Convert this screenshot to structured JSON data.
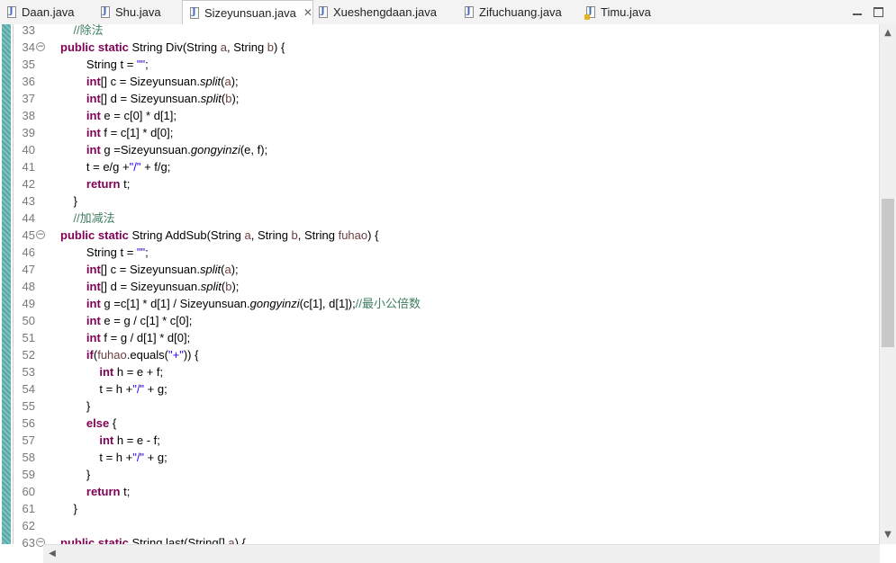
{
  "tabs": [
    {
      "label": "Daan.java",
      "warn": false
    },
    {
      "label": "Shu.java",
      "warn": false
    },
    {
      "label": "Sizeyunsuan.java",
      "warn": false,
      "active": true
    },
    {
      "label": "Xueshengdaan.java",
      "warn": false
    },
    {
      "label": "Zifuchuang.java",
      "warn": false
    },
    {
      "label": "Timu.java",
      "warn": true
    }
  ],
  "tab_close_glyph": "✕",
  "icons": {
    "file": "java-file-icon",
    "close": "close-icon",
    "minimize": "minimize-icon",
    "maximize": "maximize-icon",
    "fold": "fold-collapse-icon",
    "scroll_up": "scroll-up-icon",
    "scroll_down": "scroll-down-icon",
    "scroll_left": "scroll-left-icon"
  },
  "editor": {
    "fold_glyph": "−",
    "lines": [
      {
        "n": "33",
        "fold": false,
        "tokens": [
          [
            "c",
            "    //除法"
          ]
        ]
      },
      {
        "n": "34",
        "fold": true,
        "tokens": [
          [
            "k",
            "public"
          ],
          [
            "t",
            " "
          ],
          [
            "k",
            "static"
          ],
          [
            "t",
            " String Div(String "
          ],
          [
            "p",
            "a"
          ],
          [
            "t",
            ", String "
          ],
          [
            "p",
            "b"
          ],
          [
            "t",
            ") {"
          ]
        ]
      },
      {
        "n": "35",
        "fold": false,
        "tokens": [
          [
            "t",
            "        String t = "
          ],
          [
            "s",
            "\"\""
          ],
          [
            "t",
            ";"
          ]
        ]
      },
      {
        "n": "36",
        "fold": false,
        "tokens": [
          [
            "t",
            "        "
          ],
          [
            "k",
            "int"
          ],
          [
            "t",
            "[] c = Sizeyunsuan."
          ],
          [
            "m",
            "split"
          ],
          [
            "t",
            "("
          ],
          [
            "p",
            "a"
          ],
          [
            "t",
            ");"
          ]
        ]
      },
      {
        "n": "37",
        "fold": false,
        "tokens": [
          [
            "t",
            "        "
          ],
          [
            "k",
            "int"
          ],
          [
            "t",
            "[] d = Sizeyunsuan."
          ],
          [
            "m",
            "split"
          ],
          [
            "t",
            "("
          ],
          [
            "p",
            "b"
          ],
          [
            "t",
            ");"
          ]
        ]
      },
      {
        "n": "38",
        "fold": false,
        "tokens": [
          [
            "t",
            "        "
          ],
          [
            "k",
            "int"
          ],
          [
            "t",
            " e = c[0] * d[1];"
          ]
        ]
      },
      {
        "n": "39",
        "fold": false,
        "tokens": [
          [
            "t",
            "        "
          ],
          [
            "k",
            "int"
          ],
          [
            "t",
            " f = c[1] * d[0];"
          ]
        ]
      },
      {
        "n": "40",
        "fold": false,
        "tokens": [
          [
            "t",
            "        "
          ],
          [
            "k",
            "int"
          ],
          [
            "t",
            " g =Sizeyunsuan."
          ],
          [
            "m",
            "gongyinzi"
          ],
          [
            "t",
            "(e, f);"
          ]
        ]
      },
      {
        "n": "41",
        "fold": false,
        "tokens": [
          [
            "t",
            "        t = e/g +"
          ],
          [
            "s",
            "\"/\""
          ],
          [
            "t",
            " + f/g;"
          ]
        ]
      },
      {
        "n": "42",
        "fold": false,
        "tokens": [
          [
            "t",
            "        "
          ],
          [
            "k",
            "return"
          ],
          [
            "t",
            " t;"
          ]
        ]
      },
      {
        "n": "43",
        "fold": false,
        "tokens": [
          [
            "t",
            "    }"
          ]
        ]
      },
      {
        "n": "44",
        "fold": false,
        "tokens": [
          [
            "c",
            "    //加减法"
          ]
        ]
      },
      {
        "n": "45",
        "fold": true,
        "tokens": [
          [
            "k",
            "public"
          ],
          [
            "t",
            " "
          ],
          [
            "k",
            "static"
          ],
          [
            "t",
            " String AddSub(String "
          ],
          [
            "p",
            "a"
          ],
          [
            "t",
            ", String "
          ],
          [
            "p",
            "b"
          ],
          [
            "t",
            ", String "
          ],
          [
            "p",
            "fuhao"
          ],
          [
            "t",
            ") {"
          ]
        ]
      },
      {
        "n": "46",
        "fold": false,
        "tokens": [
          [
            "t",
            "        String t = "
          ],
          [
            "s",
            "\"\""
          ],
          [
            "t",
            ";"
          ]
        ]
      },
      {
        "n": "47",
        "fold": false,
        "tokens": [
          [
            "t",
            "        "
          ],
          [
            "k",
            "int"
          ],
          [
            "t",
            "[] c = Sizeyunsuan."
          ],
          [
            "m",
            "split"
          ],
          [
            "t",
            "("
          ],
          [
            "p",
            "a"
          ],
          [
            "t",
            ");"
          ]
        ]
      },
      {
        "n": "48",
        "fold": false,
        "tokens": [
          [
            "t",
            "        "
          ],
          [
            "k",
            "int"
          ],
          [
            "t",
            "[] d = Sizeyunsuan."
          ],
          [
            "m",
            "split"
          ],
          [
            "t",
            "("
          ],
          [
            "p",
            "b"
          ],
          [
            "t",
            ");"
          ]
        ]
      },
      {
        "n": "49",
        "fold": false,
        "tokens": [
          [
            "t",
            "        "
          ],
          [
            "k",
            "int"
          ],
          [
            "t",
            " g =c[1] * d[1] / Sizeyunsuan."
          ],
          [
            "m",
            "gongyinzi"
          ],
          [
            "t",
            "(c[1], d[1]);"
          ],
          [
            "c",
            "//最小公倍数"
          ]
        ]
      },
      {
        "n": "50",
        "fold": false,
        "tokens": [
          [
            "t",
            "        "
          ],
          [
            "k",
            "int"
          ],
          [
            "t",
            " e = g / c[1] * c[0];"
          ]
        ]
      },
      {
        "n": "51",
        "fold": false,
        "tokens": [
          [
            "t",
            "        "
          ],
          [
            "k",
            "int"
          ],
          [
            "t",
            " f = g / d[1] * d[0];"
          ]
        ]
      },
      {
        "n": "52",
        "fold": false,
        "tokens": [
          [
            "t",
            "        "
          ],
          [
            "k",
            "if"
          ],
          [
            "t",
            "("
          ],
          [
            "p",
            "fuhao"
          ],
          [
            "t",
            ".equals("
          ],
          [
            "s",
            "\"+\""
          ],
          [
            "t",
            ")) {"
          ]
        ]
      },
      {
        "n": "53",
        "fold": false,
        "tokens": [
          [
            "t",
            "            "
          ],
          [
            "k",
            "int"
          ],
          [
            "t",
            " h = e + f;"
          ]
        ]
      },
      {
        "n": "54",
        "fold": false,
        "tokens": [
          [
            "t",
            "            t = h +"
          ],
          [
            "s",
            "\"/\""
          ],
          [
            "t",
            " + g;"
          ]
        ]
      },
      {
        "n": "55",
        "fold": false,
        "tokens": [
          [
            "t",
            "        }"
          ]
        ]
      },
      {
        "n": "56",
        "fold": false,
        "tokens": [
          [
            "t",
            "        "
          ],
          [
            "k",
            "else"
          ],
          [
            "t",
            " {"
          ]
        ]
      },
      {
        "n": "57",
        "fold": false,
        "tokens": [
          [
            "t",
            "            "
          ],
          [
            "k",
            "int"
          ],
          [
            "t",
            " h = e - f;"
          ]
        ]
      },
      {
        "n": "58",
        "fold": false,
        "tokens": [
          [
            "t",
            "            t = h +"
          ],
          [
            "s",
            "\"/\""
          ],
          [
            "t",
            " + g;"
          ]
        ]
      },
      {
        "n": "59",
        "fold": false,
        "tokens": [
          [
            "t",
            "        }"
          ]
        ]
      },
      {
        "n": "60",
        "fold": false,
        "tokens": [
          [
            "t",
            "        "
          ],
          [
            "k",
            "return"
          ],
          [
            "t",
            " t;"
          ]
        ]
      },
      {
        "n": "61",
        "fold": false,
        "tokens": [
          [
            "t",
            "    }"
          ]
        ]
      },
      {
        "n": "62",
        "fold": false,
        "tokens": [
          [
            "t",
            ""
          ]
        ]
      },
      {
        "n": "63",
        "fold": true,
        "tokens": [
          [
            "k",
            "public"
          ],
          [
            "t",
            " "
          ],
          [
            "k",
            "static"
          ],
          [
            "t",
            " String last(String[] "
          ],
          [
            "p",
            "a"
          ],
          [
            "t",
            ") {"
          ]
        ]
      }
    ]
  },
  "scroll": {
    "vertical_position": 0.42,
    "vertical_visible_fraction": 0.29
  }
}
